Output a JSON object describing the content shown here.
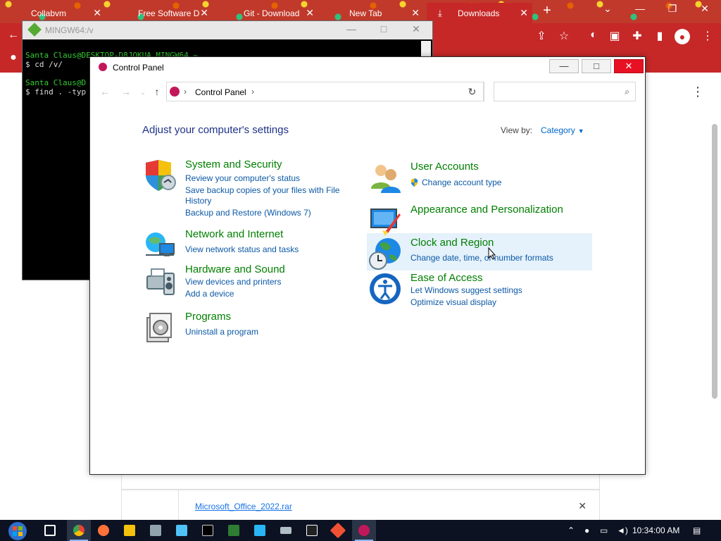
{
  "chrome": {
    "tabs": [
      {
        "label": "Collabvm"
      },
      {
        "label": "Free Software D"
      },
      {
        "label": "Git - Download"
      },
      {
        "label": "New Tab"
      },
      {
        "label": "Downloads"
      }
    ],
    "page_download": {
      "file_name": "Microsoft_Office_2022.rar"
    }
  },
  "terminal": {
    "title": "MINGW64:/v",
    "lines": [
      {
        "prompt": "Santa Claus@DESKTOP-D8JOKUA MINGW64 ~",
        "cmd": "$ cd /v/"
      },
      {
        "prompt": "Santa Claus@D",
        "cmd": "$ find . -typ"
      }
    ]
  },
  "control_panel": {
    "window_title": "Control Panel",
    "address": {
      "path": "Control Panel"
    },
    "search": {
      "placeholder": ""
    },
    "heading": "Adjust your computer's settings",
    "view_by": {
      "label": "View by:",
      "value": "Category"
    },
    "categories_left": [
      {
        "title": "System and Security",
        "icon": "shield-icon",
        "links": [
          "Review your computer's status",
          "Save backup copies of your files with File History",
          "Backup and Restore (Windows 7)"
        ]
      },
      {
        "title": "Network and Internet",
        "icon": "network-icon",
        "links": [
          "View network status and tasks"
        ]
      },
      {
        "title": "Hardware and Sound",
        "icon": "printer-icon",
        "links": [
          "View devices and printers",
          "Add a device"
        ]
      },
      {
        "title": "Programs",
        "icon": "programs-icon",
        "links": [
          "Uninstall a program"
        ]
      }
    ],
    "categories_right": [
      {
        "title": "User Accounts",
        "icon": "users-icon",
        "links": [
          "Change account type"
        ]
      },
      {
        "title": "Appearance and Personalization",
        "icon": "appearance-icon",
        "links": []
      },
      {
        "title": "Clock and Region",
        "icon": "globe-clock-icon",
        "links": [
          "Change date, time, or number formats"
        ]
      },
      {
        "title": "Ease of Access",
        "icon": "ease-of-access-icon",
        "links": [
          "Let Windows suggest settings",
          "Optimize visual display"
        ]
      }
    ]
  },
  "taskbar": {
    "clock": "10:34:00 AM",
    "apps": [
      "task-view",
      "chrome",
      "firefox",
      "file-explorer",
      "image-viewer",
      "monitor",
      "command-prompt",
      "spreadsheet",
      "grid-app",
      "keyboard",
      "7zip",
      "git",
      "control-panel"
    ]
  },
  "colors": {
    "chrome_theme": "#c62828",
    "category_title": "#007f00",
    "link": "#0c59a6",
    "heading": "#1e3287",
    "hover_highlight": "#e5f1fb",
    "close_button": "#e81123"
  }
}
